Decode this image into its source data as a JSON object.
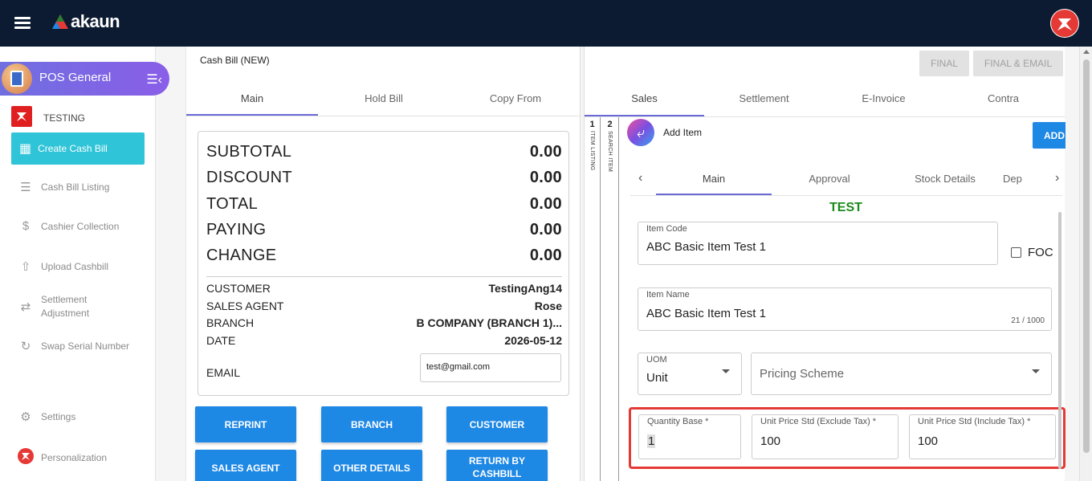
{
  "app": {
    "logo_text": "akaun",
    "module": "POS General",
    "company": "TESTING"
  },
  "sidebar": {
    "active_item": "Create Cash Bill",
    "items": [
      {
        "label": "Cash Bill Listing",
        "icon": "list-icon"
      },
      {
        "label": "Cashier Collection",
        "icon": "dollar-icon"
      },
      {
        "label": "Upload Cashbill",
        "icon": "upload-file-icon"
      },
      {
        "label": "Settlement Adjustment",
        "icon": "swap-arrows-icon"
      },
      {
        "label": "Swap Serial Number",
        "icon": "refresh-icon"
      },
      {
        "label": "Settings",
        "icon": "gear-icon"
      },
      {
        "label": "Personalization",
        "icon": "brand-logo-icon"
      }
    ]
  },
  "bill": {
    "title": "Cash Bill (NEW)",
    "tabs": [
      "Main",
      "Hold Bill",
      "Copy From"
    ],
    "summary": [
      {
        "label": "SUBTOTAL",
        "value": "0.00"
      },
      {
        "label": "DISCOUNT",
        "value": "0.00"
      },
      {
        "label": "TOTAL",
        "value": "0.00"
      },
      {
        "label": "PAYING",
        "value": "0.00"
      },
      {
        "label": "CHANGE",
        "value": "0.00"
      }
    ],
    "info": [
      {
        "label": "CUSTOMER",
        "value": "TestingAng14"
      },
      {
        "label": "SALES AGENT",
        "value": "Rose"
      },
      {
        "label": "BRANCH",
        "value": "B COMPANY (BRANCH 1)..."
      },
      {
        "label": "DATE",
        "value": "2026-05-12"
      }
    ],
    "email_label": "EMAIL",
    "email_value": "test@gmail.com",
    "buttons": [
      "REPRINT",
      "BRANCH",
      "CUSTOMER",
      "SALES AGENT",
      "OTHER DETAILS",
      "RETURN BY CASHBILL"
    ]
  },
  "right": {
    "final_button": "FINAL",
    "final_email_button": "FINAL & EMAIL",
    "tabs": [
      "Sales",
      "Settlement",
      "E-Invoice",
      "Contra"
    ],
    "strip1": {
      "num": "1",
      "label": "ITEM LISTING"
    },
    "strip2": {
      "num": "2",
      "label": "SEARCH ITEM"
    },
    "add_item_label": "Add Item",
    "add_button": "ADD",
    "subtabs": [
      "Main",
      "Approval",
      "Stock Details",
      "Dep"
    ],
    "test_label": "TEST",
    "item_code": {
      "label": "Item Code",
      "value": "ABC Basic Item Test 1"
    },
    "foc_label": "FOC",
    "item_name": {
      "label": "Item Name",
      "value": "ABC Basic Item Test 1",
      "count": "21 / 1000"
    },
    "uom": {
      "label": "UOM",
      "value": "Unit"
    },
    "pricing_scheme": {
      "placeholder": "Pricing Scheme"
    },
    "quantity_base": {
      "label": "Quantity Base *",
      "value": "1"
    },
    "unit_price_excl": {
      "label": "Unit Price Std (Exclude Tax) *",
      "value": "100"
    },
    "unit_price_incl": {
      "label": "Unit Price Std (Include Tax) *",
      "value": "100"
    }
  },
  "colors": {
    "topbar": "#0c1b31",
    "accent_cyan": "#2fc4d8",
    "button_blue": "#1e88e5",
    "highlight_red": "#e53935",
    "test_green": "#1a8a1a"
  }
}
